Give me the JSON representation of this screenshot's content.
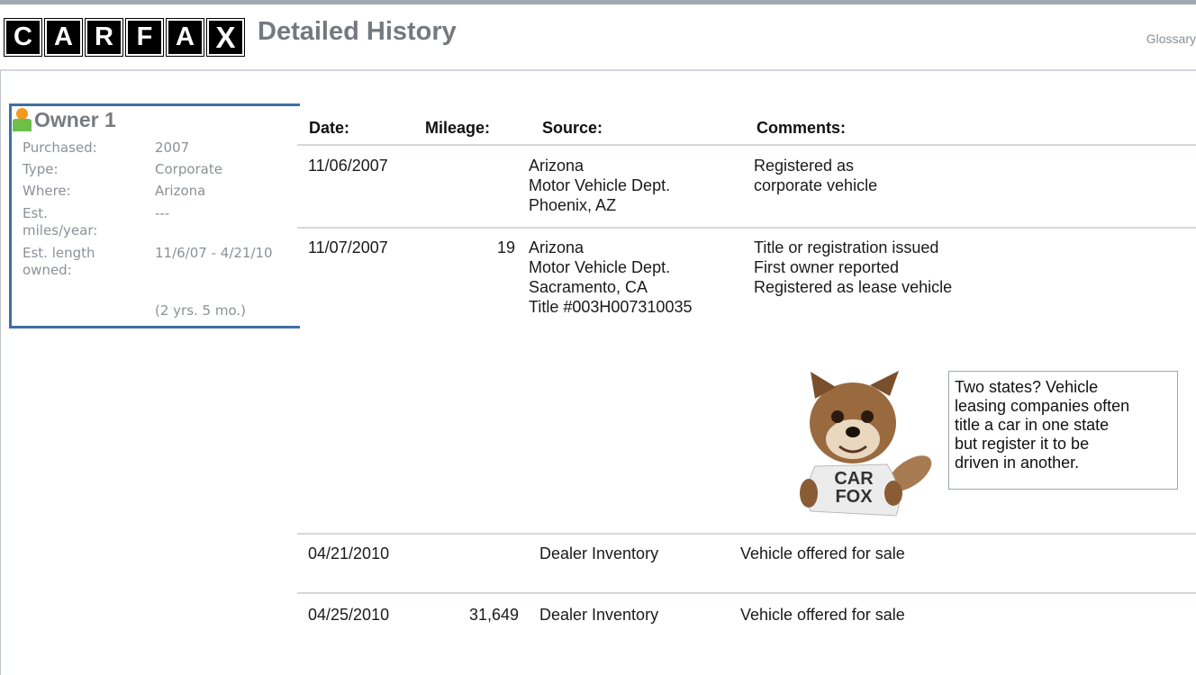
{
  "header": {
    "logo_letters": [
      "C",
      "A",
      "R",
      "F",
      "A",
      "X"
    ],
    "title": "Detailed History",
    "glossary": "Glossary"
  },
  "owner": {
    "title": "Owner 1",
    "fields": [
      {
        "label": "Purchased:",
        "value": "2007"
      },
      {
        "label": "Type:",
        "value": "Corporate"
      },
      {
        "label": "Where:",
        "value": "Arizona"
      },
      {
        "label": "Est. miles/year:",
        "value": "---"
      },
      {
        "label": "Est. length owned:",
        "value": "11/6/07 - 4/21/10"
      }
    ],
    "length_note": "(2 yrs. 5 mo.)"
  },
  "table": {
    "headers": {
      "date": "Date:",
      "mileage": "Mileage:",
      "source": "Source:",
      "comments": "Comments:"
    },
    "rows": [
      {
        "date": "11/06/2007",
        "mileage": "",
        "source": [
          "Arizona",
          "Motor Vehicle Dept.",
          "Phoenix, AZ"
        ],
        "comments": [
          "Registered as",
          "corporate vehicle"
        ]
      },
      {
        "date": "11/07/2007",
        "mileage": "19",
        "source": [
          "Arizona",
          "Motor Vehicle Dept.",
          "Sacramento, CA",
          "Title #003H007310035"
        ],
        "comments": [
          "Title or registration issued",
          "First owner reported",
          "Registered as lease vehicle"
        ]
      },
      {
        "date": "04/21/2010",
        "mileage": "",
        "source": [
          "Dealer Inventory"
        ],
        "comments": [
          "Vehicle offered for sale"
        ]
      },
      {
        "date": "04/25/2010",
        "mileage": "31,649",
        "source": [
          "Dealer Inventory"
        ],
        "comments": [
          "Vehicle offered for sale"
        ]
      }
    ]
  },
  "tip": {
    "lines": [
      "Two states? Vehicle",
      "leasing companies often",
      "title a car in one state",
      "but register it to be",
      "driven in another."
    ]
  },
  "mascot": {
    "shirt_line1": "CAR",
    "shirt_line2": "FOX"
  }
}
